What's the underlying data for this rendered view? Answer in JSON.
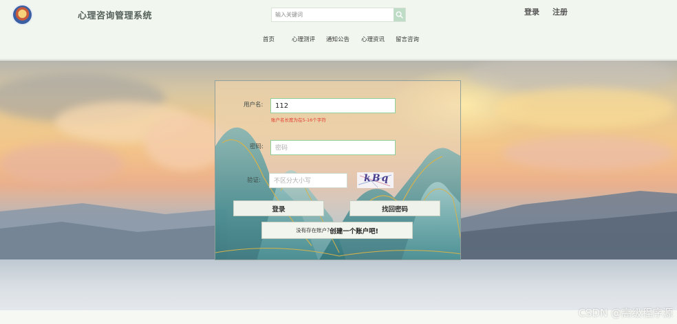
{
  "header": {
    "app_title": "心理咨询管理系统",
    "search": {
      "placeholder": "输入关键词",
      "value": ""
    },
    "login_link": "登录",
    "register_link": "注册",
    "nav": [
      {
        "label": "首页"
      },
      {
        "label": "心理测评"
      },
      {
        "label": "通知公告"
      },
      {
        "label": "心理资讯"
      },
      {
        "label": "留言咨询"
      }
    ]
  },
  "login_form": {
    "username_label": "用户名:",
    "username_value": "112",
    "username_error": "账户名长度为在5-16个字符",
    "password_label": "密码:",
    "password_placeholder": "密码",
    "captcha_label": "验证:",
    "captcha_placeholder": "不区分大小写",
    "captcha_text": "kBq",
    "login_button": "登录",
    "recover_button": "找回密码",
    "register_prompt_small": "没有存在账户?",
    "register_prompt_big": "创建一个账户吧!"
  },
  "watermark": "CSDN @高级程序源",
  "colors": {
    "header_bg": "#f1f6ef",
    "input_border": "#8fcf9a",
    "error": "#e03a2f",
    "search_button": "#bfdcc6"
  },
  "icons": {
    "search": "search-icon",
    "logo": "logo-icon"
  }
}
